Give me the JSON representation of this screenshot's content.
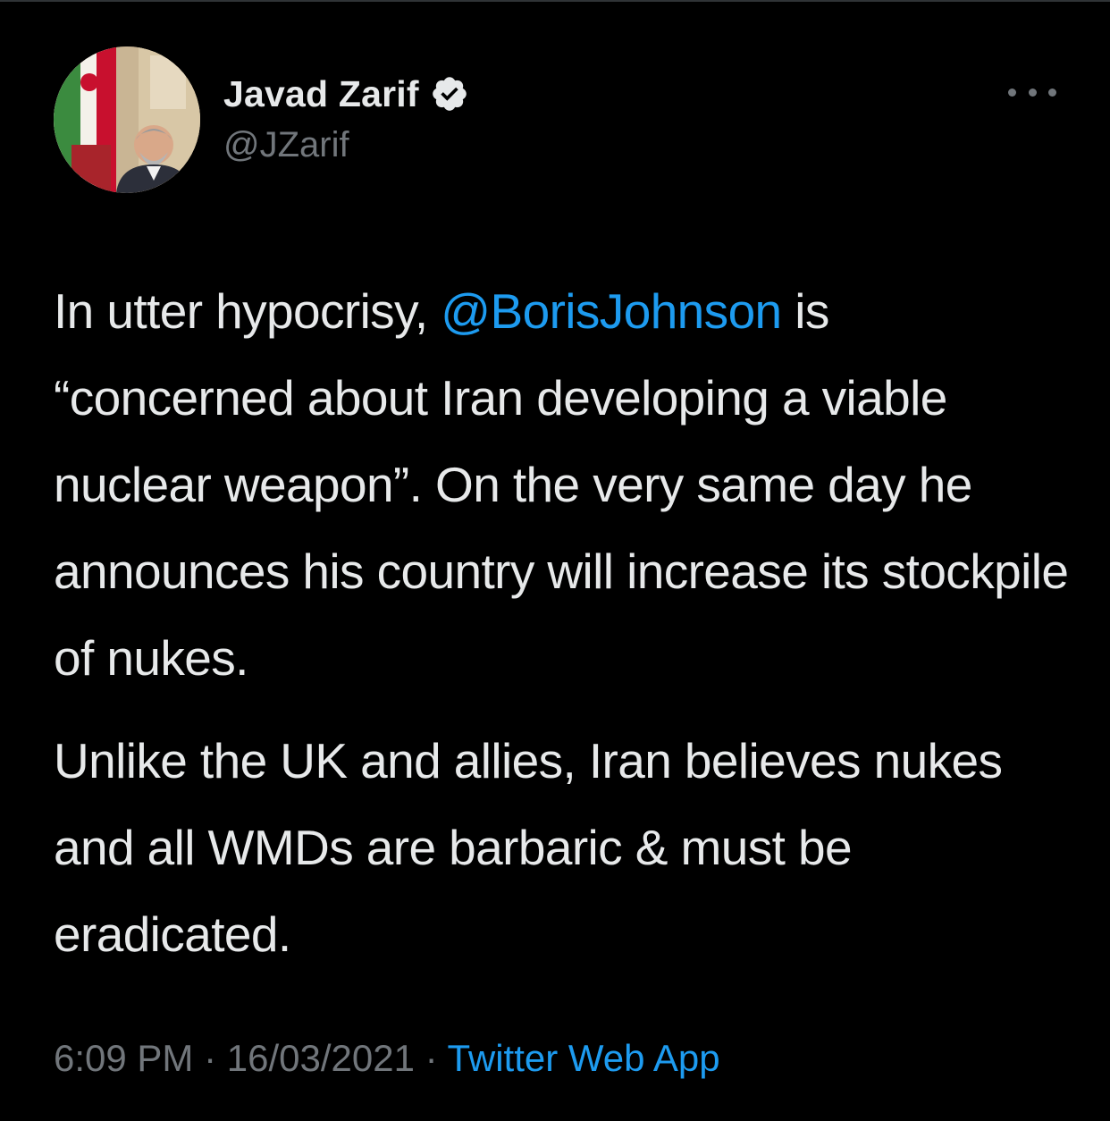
{
  "colors": {
    "background": "#000000",
    "text": "#e7e9ea",
    "secondary_text": "#71767b",
    "accent": "#1d9bf0"
  },
  "author": {
    "name": "Javad Zarif",
    "handle": "@JZarif",
    "verified": true,
    "avatar_icon": "profile-photo"
  },
  "more_icon": "ellipsis-icon",
  "tweet": {
    "paragraph1": {
      "before": "In utter hypocrisy, ",
      "mention": "@BorisJohnson",
      "after": " is “concerned about Iran developing a viable nuclear weapon”. On the very same day he announces his country will increase its stockpile of nukes."
    },
    "paragraph2": "Unlike the UK and allies, Iran believes nukes and all WMDs are barbaric & must be eradicated."
  },
  "meta": {
    "time": "6:09 PM",
    "separator": " · ",
    "date": "16/03/2021",
    "source": "Twitter Web App"
  }
}
